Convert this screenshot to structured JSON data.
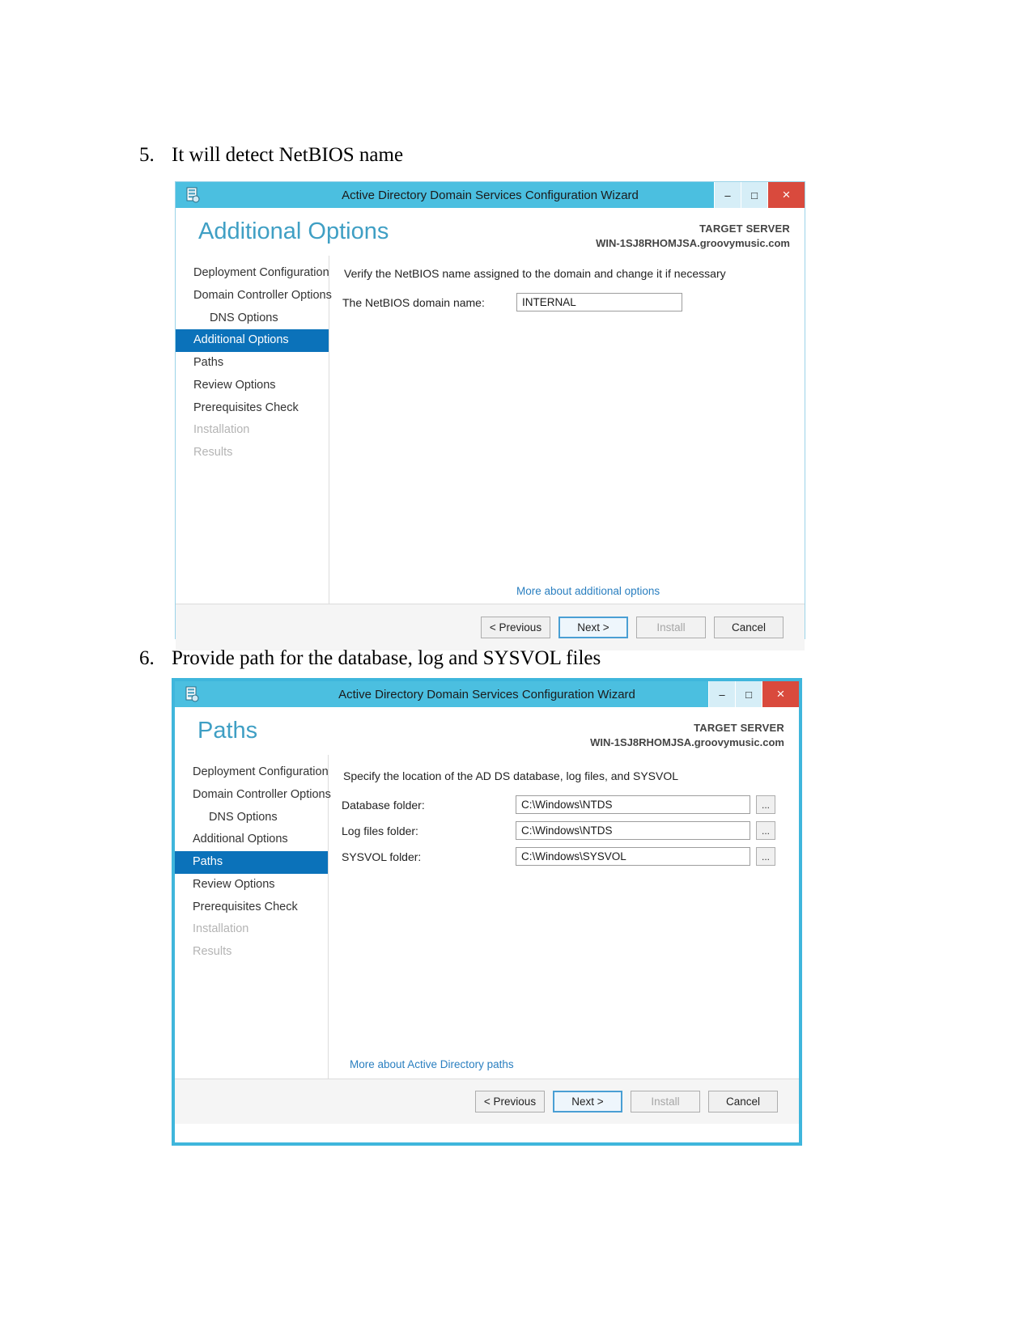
{
  "document": {
    "steps": [
      {
        "number": "5.",
        "text": "It will detect NetBIOS name"
      },
      {
        "number": "6.",
        "text": "Provide path for the database, log and SYSVOL files"
      }
    ]
  },
  "wizard_additional_options": {
    "title": "Active Directory Domain Services Configuration Wizard",
    "icon": "server-wizard-icon",
    "window_buttons": {
      "minimize": "–",
      "maximize": "□",
      "close": "×"
    },
    "page_title": "Additional Options",
    "target_server_label": "TARGET SERVER",
    "target_server_name": "WIN-1SJ8RHOMJSA.groovymusic.com",
    "nav_items": [
      {
        "label": "Deployment Configuration",
        "state": "normal",
        "indent": false
      },
      {
        "label": "Domain Controller Options",
        "state": "normal",
        "indent": false
      },
      {
        "label": "DNS Options",
        "state": "normal",
        "indent": true
      },
      {
        "label": "Additional Options",
        "state": "selected",
        "indent": false
      },
      {
        "label": "Paths",
        "state": "normal",
        "indent": false
      },
      {
        "label": "Review Options",
        "state": "normal",
        "indent": false
      },
      {
        "label": "Prerequisites Check",
        "state": "normal",
        "indent": false
      },
      {
        "label": "Installation",
        "state": "disabled",
        "indent": false
      },
      {
        "label": "Results",
        "state": "disabled",
        "indent": false
      }
    ],
    "intro": "Verify the NetBIOS name assigned to the domain and change it if necessary",
    "netbios_label": "The NetBIOS domain name:",
    "netbios_value": "INTERNAL",
    "more_link": "More about additional options",
    "buttons": {
      "previous": "< Previous",
      "next": "Next >",
      "install": "Install",
      "cancel": "Cancel"
    }
  },
  "wizard_paths": {
    "title": "Active Directory Domain Services Configuration Wizard",
    "icon": "server-wizard-icon",
    "window_buttons": {
      "minimize": "–",
      "maximize": "□",
      "close": "×"
    },
    "page_title": "Paths",
    "target_server_label": "TARGET SERVER",
    "target_server_name": "WIN-1SJ8RHOMJSA.groovymusic.com",
    "nav_items": [
      {
        "label": "Deployment Configuration",
        "state": "normal",
        "indent": false
      },
      {
        "label": "Domain Controller Options",
        "state": "normal",
        "indent": false
      },
      {
        "label": "DNS Options",
        "state": "normal",
        "indent": true
      },
      {
        "label": "Additional Options",
        "state": "normal",
        "indent": false
      },
      {
        "label": "Paths",
        "state": "selected",
        "indent": false
      },
      {
        "label": "Review Options",
        "state": "normal",
        "indent": false
      },
      {
        "label": "Prerequisites Check",
        "state": "normal",
        "indent": false
      },
      {
        "label": "Installation",
        "state": "disabled",
        "indent": false
      },
      {
        "label": "Results",
        "state": "disabled",
        "indent": false
      }
    ],
    "intro": "Specify the location of the AD DS database, log files, and SYSVOL",
    "fields": [
      {
        "label": "Database folder:",
        "value": "C:\\Windows\\NTDS",
        "browse": "..."
      },
      {
        "label": "Log files folder:",
        "value": "C:\\Windows\\NTDS",
        "browse": "..."
      },
      {
        "label": "SYSVOL folder:",
        "value": "C:\\Windows\\SYSVOL",
        "browse": "..."
      }
    ],
    "more_link": "More about Active Directory paths",
    "buttons": {
      "previous": "< Previous",
      "next": "Next >",
      "install": "Install",
      "cancel": "Cancel"
    }
  },
  "colors": {
    "title_bar": "#4bbfe0",
    "close_button": "#d94a3d",
    "selected_nav": "#0b72ba",
    "page_title": "#3f9fc4",
    "link": "#2a7fc0"
  }
}
